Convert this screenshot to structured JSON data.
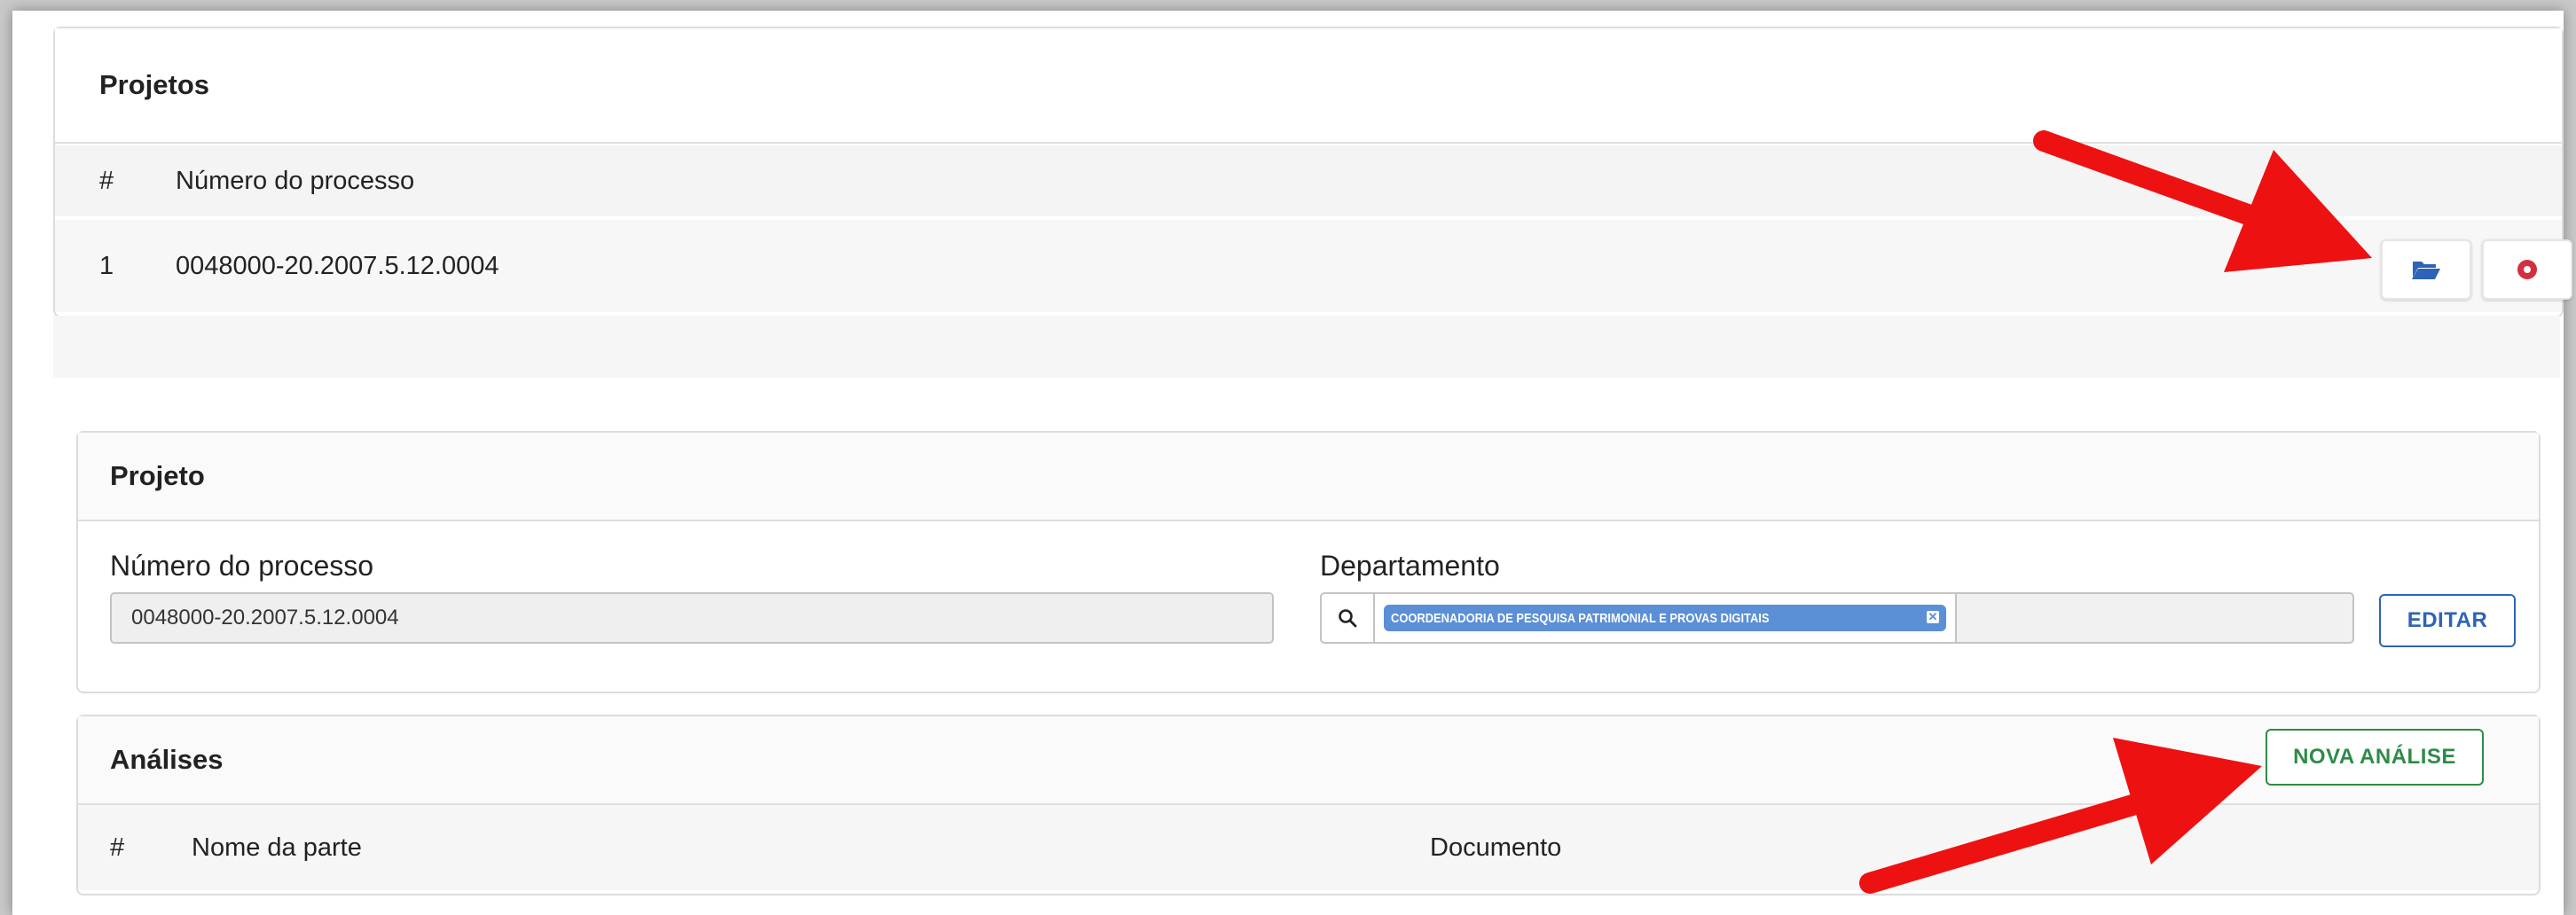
{
  "projects_card": {
    "title": "Projetos",
    "columns": {
      "index": "#",
      "process": "Número do processo"
    },
    "rows": [
      {
        "index": "1",
        "process": "0048000-20.2007.5.12.0004"
      }
    ]
  },
  "project_card": {
    "title": "Projeto",
    "process_label": "Número do processo",
    "process_value": "0048000-20.2007.5.12.0004",
    "department_label": "Departamento",
    "department_tag": "COORDENADORIA DE PESQUISA PATRIMONIAL E PROVAS DIGITAIS",
    "edit_button": "EDITAR"
  },
  "analyses_card": {
    "title": "Análises",
    "new_button": "NOVA ANÁLISE",
    "columns": {
      "index": "#",
      "party": "Nome da parte",
      "document": "Documento"
    }
  },
  "colors": {
    "open_icon": "#2e63b8",
    "delete_icon": "#d32f3f",
    "edit_accent": "#2e63b8",
    "new_accent": "#2e8b47",
    "arrow": "#ee1111"
  },
  "icons": {
    "open": "folder-open-icon",
    "delete": "stop-circle-icon",
    "search": "search-icon",
    "tag_remove": "close-icon"
  }
}
